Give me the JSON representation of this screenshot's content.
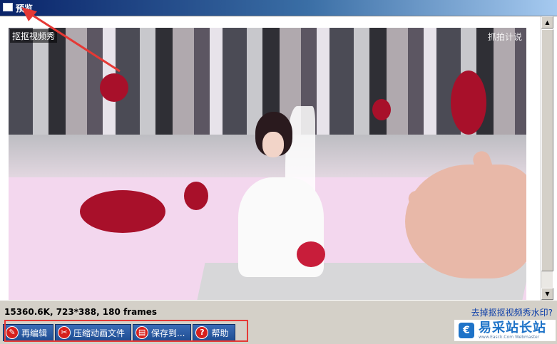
{
  "window": {
    "title": "预览"
  },
  "preview": {
    "watermark": "抠抠视频秀",
    "corner_mark": "抓拍计说"
  },
  "status": {
    "info": "15360.6K, 723*388, 180 frames",
    "remove_watermark_link": "去掉抠抠视频秀水印?"
  },
  "toolbar": {
    "buttons": [
      {
        "label": "再编辑",
        "icon": "wrench-icon"
      },
      {
        "label": "压缩动画文件",
        "icon": "scissors-icon"
      },
      {
        "label": "保存到...",
        "icon": "save-icon"
      },
      {
        "label": "帮助",
        "icon": "help-icon"
      }
    ]
  },
  "logo": {
    "text": "易采站长站",
    "subtext": "www.Easck.Com Webmaster"
  },
  "colors": {
    "annotation_red": "#e53935",
    "toolbar_blue": "#2a5aa3",
    "link_blue": "#0b3da8"
  }
}
